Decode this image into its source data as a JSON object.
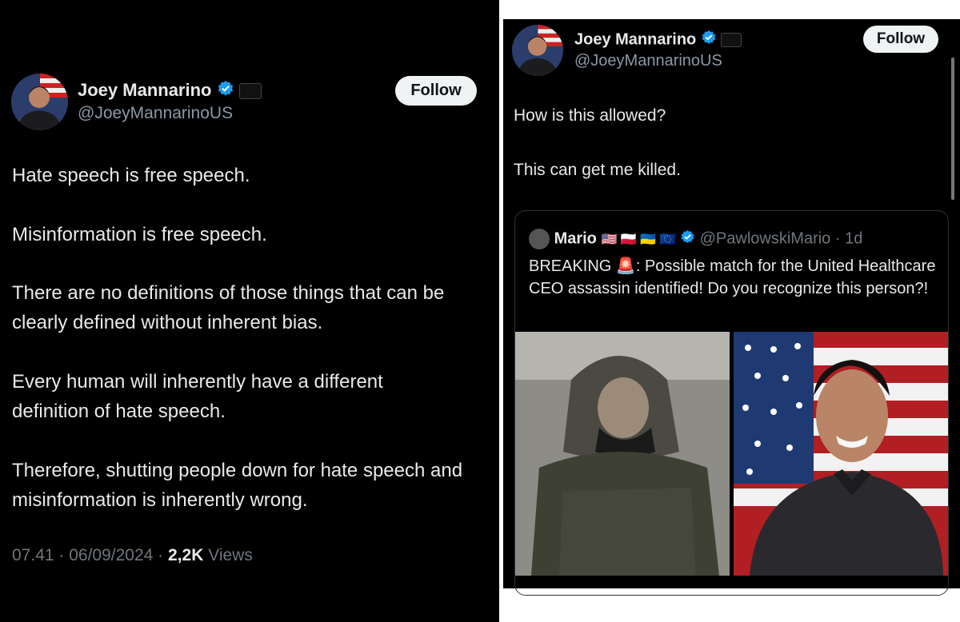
{
  "left": {
    "author": {
      "name": "Joey Mannarino",
      "handle": "@JoeyMannarinoUS"
    },
    "follow_label": "Follow",
    "paragraphs": [
      "Hate speech is free speech.",
      "Misinformation is free speech.",
      "There are no definitions of those things that can be clearly defined without inherent bias.",
      "Every human will inherently have a different definition of hate speech.",
      "Therefore, shutting people down for hate speech and misinformation is inherently wrong."
    ],
    "time": "07.41",
    "date": "06/09/2024",
    "views_count": "2,2K",
    "views_label": "Views"
  },
  "right": {
    "author": {
      "name": "Joey Mannarino",
      "handle": "@JoeyMannarinoUS"
    },
    "follow_label": "Follow",
    "paragraphs": [
      "How is this allowed?",
      "This can get me killed."
    ],
    "quote": {
      "name": "Mario",
      "flags": "🇺🇸 🇵🇱 🇺🇦 🇪🇺",
      "handle": "@PawlowskiMario",
      "age": "1d",
      "text_start": "BREAKING",
      "siren": "🚨",
      "text_rest": ": Possible match for the United Healthcare CEO assassin identified! Do you recognize this person?!"
    }
  },
  "colors": {
    "background": "#000000",
    "text": "#e7e9ea",
    "muted": "#71767b",
    "verified": "#1d9bf0",
    "follow_bg": "#eff3f4"
  },
  "icons": [
    "verified-badge-icon",
    "affiliation-badge-icon",
    "siren-icon"
  ]
}
